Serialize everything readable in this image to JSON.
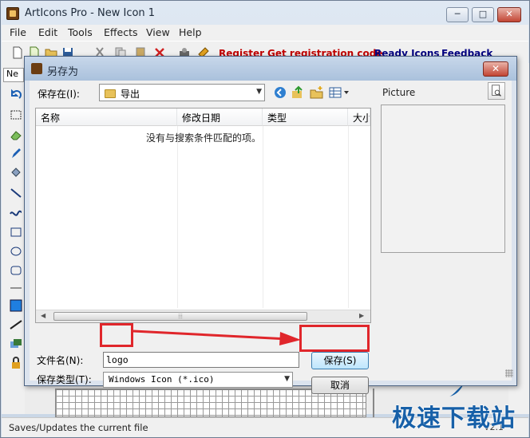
{
  "app": {
    "title": "ArtIcons Pro - New Icon 1",
    "caption_min": "─",
    "caption_max": "□",
    "caption_close": "✕"
  },
  "menu": [
    "File",
    "Edit",
    "Tools",
    "Effects",
    "View",
    "Help"
  ],
  "toolbar": {
    "links": [
      {
        "label": "Register",
        "color": "#c00000"
      },
      {
        "label": "Get registration code",
        "color": "#c00000"
      },
      {
        "label": "Ready Icons",
        "color": "#000080"
      },
      {
        "label": "Feedback",
        "color": "#000080"
      }
    ],
    "left_label": "Ne"
  },
  "dialog": {
    "title": "另存为",
    "close": "✕",
    "save_in_label": "保存在(I):",
    "save_in_value": "导出",
    "columns": [
      "名称",
      "修改日期",
      "类型",
      "大小"
    ],
    "empty_message": "没有与搜索条件匹配的项。",
    "scroll_thumb": "⦙⦙⦙",
    "scroll_left": "◀",
    "scroll_right": "▶",
    "picture_label": "Picture",
    "file_name_label": "文件名(N):",
    "file_name_value": "logo",
    "file_type_label": "保存类型(T):",
    "file_type_value": "Windows Icon (*.ico)",
    "save_button": "保存(S)",
    "cancel_button": "取消",
    "dropdown_arrow": "▼"
  },
  "status": {
    "text": "Saves/Updates the current file",
    "version": "V2.1"
  },
  "watermark": "极速下载站"
}
